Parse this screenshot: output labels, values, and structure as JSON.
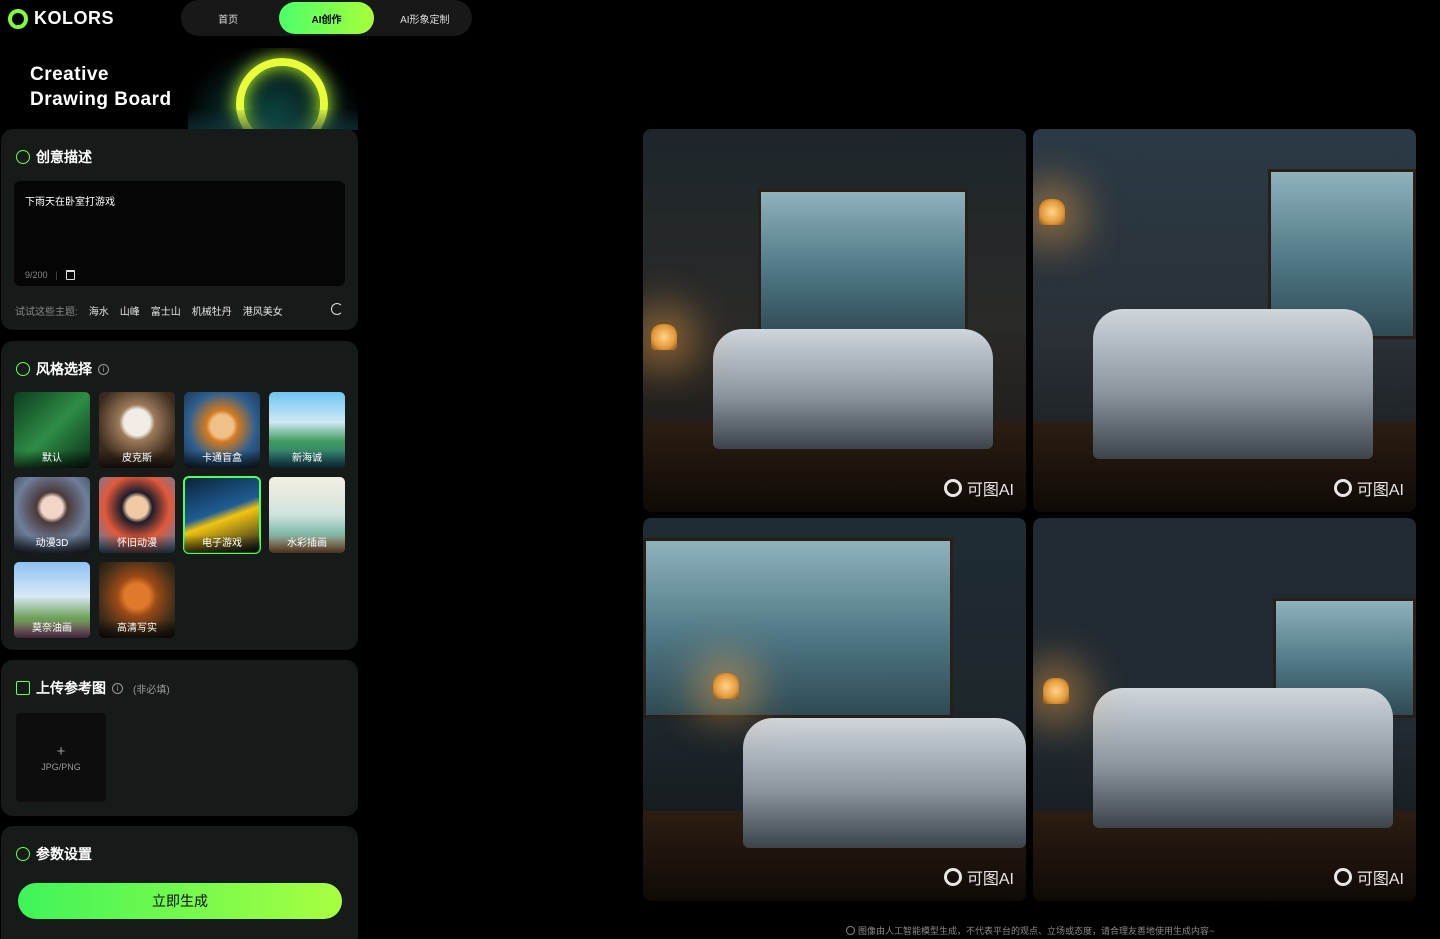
{
  "brand": {
    "name": "KOLORS"
  },
  "nav": {
    "tabs": [
      {
        "label": "首页"
      },
      {
        "label": "AI创作"
      },
      {
        "label": "AI形象定制"
      }
    ],
    "active_index": 1
  },
  "banner": {
    "line1": "Creative",
    "line2": "Drawing Board"
  },
  "description": {
    "title": "创意描述",
    "text": "下雨天在卧室打游戏",
    "counter": "9/200",
    "suggest_label": "试试这些主题:",
    "suggestions": [
      "海水",
      "山峰",
      "富士山",
      "机械牡丹",
      "港风美女"
    ]
  },
  "style": {
    "title": "风格选择",
    "items": [
      {
        "label": "默认"
      },
      {
        "label": "皮克斯"
      },
      {
        "label": "卡通盲盒"
      },
      {
        "label": "新海诚"
      },
      {
        "label": "动漫3D"
      },
      {
        "label": "怀旧动漫"
      },
      {
        "label": "电子游戏"
      },
      {
        "label": "水彩插画"
      },
      {
        "label": "莫奈油画"
      },
      {
        "label": "高清写实"
      }
    ],
    "selected": "电子游戏"
  },
  "upload": {
    "title": "上传参考图",
    "hint": "(非必填)",
    "plus": "+",
    "formats": "JPG/PNG"
  },
  "params": {
    "title": "参数设置",
    "generate_label": "立即生成"
  },
  "results": {
    "watermark": "可图AI"
  },
  "footer": {
    "notice": "图像由人工智能模型生成，不代表平台的观点、立场或态度，请合理友善地使用生成内容~"
  },
  "colors": {
    "accent": "#4dff5a",
    "accent2": "#a8ff40",
    "panel": "#161a19",
    "bg": "#000000"
  }
}
